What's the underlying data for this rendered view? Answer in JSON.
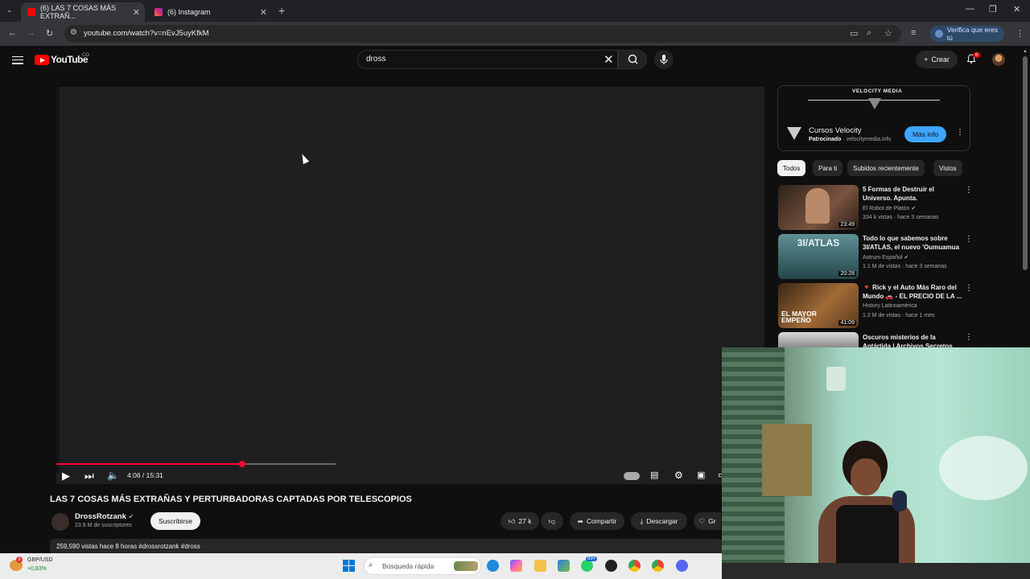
{
  "browser": {
    "tabs": [
      {
        "label": "(6) LAS 7 COSAS MÁS EXTRAÑ...",
        "active": true
      },
      {
        "label": "(6) Instagram",
        "active": false
      }
    ],
    "url": "youtube.com/watch?v=nEvJ5uyKfkM",
    "verify_label": "Verifica que eres tú"
  },
  "header": {
    "logo_text": "YouTube",
    "country_code": "CO",
    "search_value": "dross",
    "create_label": "Crear",
    "notification_count": "6"
  },
  "player": {
    "time": "4:06 / 15:31",
    "progress_fraction": 0.263,
    "buffered_fraction": 0.394
  },
  "video": {
    "title": "LAS 7 COSAS MÁS EXTRAÑAS Y PERTURBADORAS CAPTADAS POR TELESCOPIOS",
    "channel": "DrossRotzank",
    "subscribers": "23.9 M de suscriptores",
    "subscribe_label": "Suscribirse",
    "likes": "27 k",
    "share_label": "Compartir",
    "download_label": "Descargar",
    "thanks_label": "Gr",
    "meta": "259,590 vistas  hace 8 horas  #drossrotzank #dross"
  },
  "ad": {
    "brand": "VELOCITY MEDIA",
    "title": "Cursos Velocity",
    "sponsored": "Patrocinado",
    "domain": "velocitymedia.info",
    "button": "Más info"
  },
  "chips": [
    {
      "label": "Todos",
      "active": true
    },
    {
      "label": "Para ti",
      "active": false
    },
    {
      "label": "Subidos recientemente",
      "active": false
    },
    {
      "label": "Vistos",
      "active": false
    }
  ],
  "recommendations": [
    {
      "title": "5 Formas de Destruir el Universo. Apunta.",
      "channel": "El Robot de Platón",
      "meta": "334 k vistas · hace 3 semanas",
      "duration": "23:49",
      "thumb_color": "#6b4a3a"
    },
    {
      "title": "Todo lo que sabemos sobre 3I/ATLAS, el nuevo 'Oumuamua",
      "channel": "Astrum Español",
      "meta": "1.1 M de vistas · hace 3 semanas",
      "duration": "20:28",
      "thumb_color": "#3f6b70",
      "thumb_text": "3I/ATLAS"
    },
    {
      "title": "🔻 Rick y el Auto Más Raro del Mundo 🚗 - EL PRECIO DE LA ...",
      "channel": "History Latinoamérica",
      "meta": "1.2 M de vistas · hace 1 mes",
      "duration": "41:09",
      "thumb_color": "#8a5a2a",
      "thumb_text": "EL MAYOR EMPEÑO"
    },
    {
      "title": "Oscuros misterios de la Antártida | Archivos Secretos",
      "channel": "",
      "meta": "",
      "duration": "",
      "thumb_color": "#c8c8c8"
    }
  ],
  "taskbar": {
    "stock_label": "GBP/USD",
    "stock_change": "+0,83%",
    "search_placeholder": "Búsqueda rápida"
  }
}
